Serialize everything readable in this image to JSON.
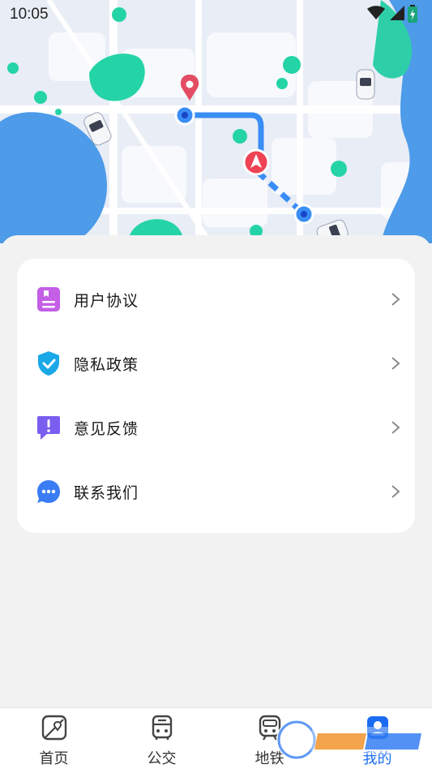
{
  "status_bar": {
    "time": "10:05"
  },
  "menu": {
    "items": [
      {
        "label": "用户协议",
        "icon": "document-icon"
      },
      {
        "label": "隐私政策",
        "icon": "shield-check-icon"
      },
      {
        "label": "意见反馈",
        "icon": "feedback-icon"
      },
      {
        "label": "联系我们",
        "icon": "chat-icon"
      }
    ]
  },
  "tabs": [
    {
      "label": "首页",
      "icon": "map-icon",
      "active": false
    },
    {
      "label": "公交",
      "icon": "bus-icon",
      "active": false
    },
    {
      "label": "地铁",
      "icon": "subway-icon",
      "active": false
    },
    {
      "label": "我的",
      "icon": "profile-icon",
      "active": true
    }
  ],
  "colors": {
    "accent": "#1b6cf2",
    "doc_icon": "#c45fe6",
    "shield_icon": "#1aa8e8",
    "feedback_icon": "#7a5ef0",
    "chat_icon": "#3a7cf3"
  }
}
